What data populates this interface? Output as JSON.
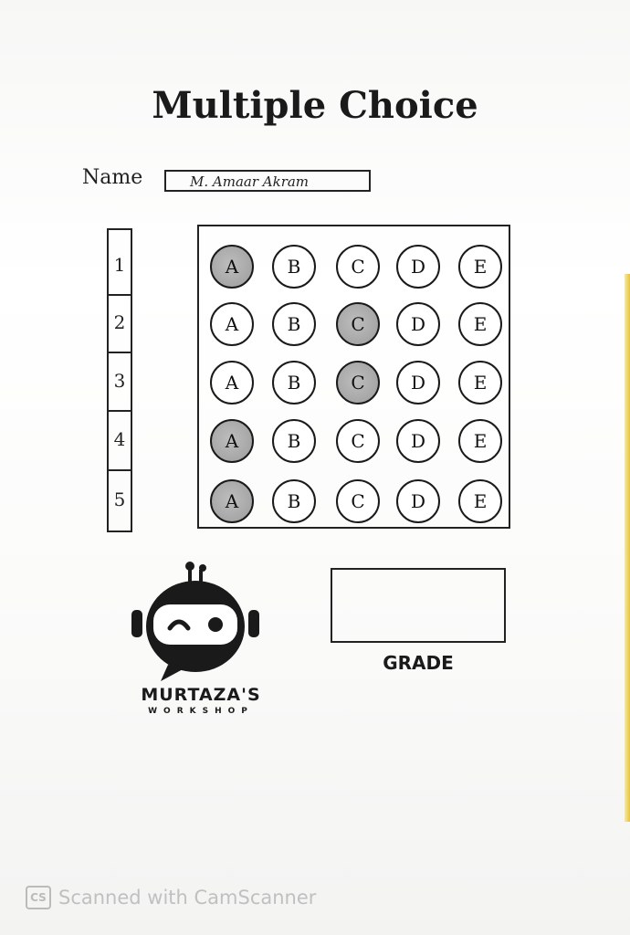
{
  "title": "Multiple Choice",
  "name_field": {
    "label": "Name",
    "value": "M. Amaar Akram"
  },
  "questions": [
    {
      "number": "1",
      "options": [
        "A",
        "B",
        "C",
        "D",
        "E"
      ],
      "selected": "A"
    },
    {
      "number": "2",
      "options": [
        "A",
        "B",
        "C",
        "D",
        "E"
      ],
      "selected": "C"
    },
    {
      "number": "3",
      "options": [
        "A",
        "B",
        "C",
        "D",
        "E"
      ],
      "selected": "C"
    },
    {
      "number": "4",
      "options": [
        "A",
        "B",
        "C",
        "D",
        "E"
      ],
      "selected": "A"
    },
    {
      "number": "5",
      "options": [
        "A",
        "B",
        "C",
        "D",
        "E"
      ],
      "selected": "A"
    }
  ],
  "logo": {
    "brand": "MURTAZA'S",
    "tagline": "WORKSHOP",
    "icon": "robot-logo-icon"
  },
  "grade": {
    "label": "GRADE",
    "value": ""
  },
  "watermark": {
    "icon_text": "CS",
    "text": "Scanned with CamScanner"
  },
  "colors": {
    "ink": "#1a1a1a",
    "filled_bubble": "#a6a6a6",
    "paper": "#ffffff",
    "edge": "#e8c43a"
  }
}
